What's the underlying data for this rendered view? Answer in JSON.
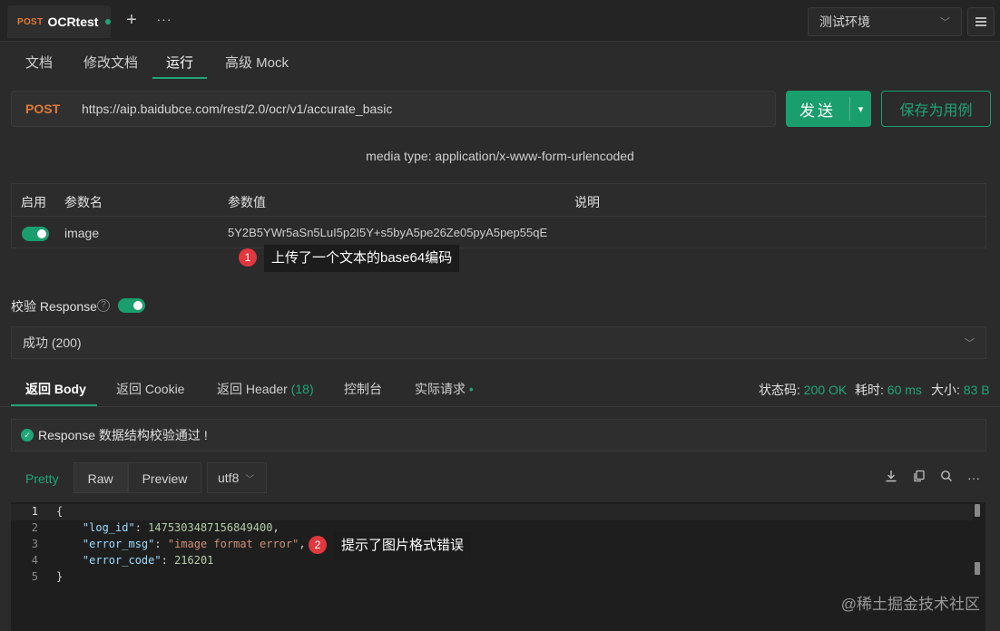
{
  "top_tab": {
    "method": "POST",
    "name": "OCRtest",
    "plus": "+",
    "more": "···"
  },
  "env": {
    "label": "测试环境",
    "chevron": "﹀"
  },
  "sub_tabs": [
    "文档",
    "修改文档",
    "运行",
    "高级 Mock"
  ],
  "request": {
    "method": "POST",
    "url": "https://aip.baidubce.com/rest/2.0/ocr/v1/accurate_basic",
    "send_label": "发送",
    "send_arrow": "▾",
    "save_label": "保存为用例"
  },
  "media_type": "media type: application/x-www-form-urlencoded",
  "params": {
    "headers": [
      "启用",
      "参数名",
      "参数值",
      "说明"
    ],
    "row": {
      "enabled": true,
      "name": "image",
      "value": "5Y2B5YWr5aSn5LuI5p2I5Y+s5byA5pe26Ze05pyA5pep55qE",
      "desc": ""
    }
  },
  "annotations": [
    {
      "num": "1",
      "text": "上传了一个文本的base64编码"
    },
    {
      "num": "2",
      "text": "提示了图片格式错误"
    }
  ],
  "validation": {
    "label": "校验 Response",
    "help": "?",
    "status": "成功 (200)",
    "chevron": "﹀"
  },
  "response_tabs": [
    {
      "label": "返回 Body"
    },
    {
      "label": "返回 Cookie"
    },
    {
      "label": "返回 Header",
      "count": "(18)"
    },
    {
      "label": "控制台"
    },
    {
      "label": "实际请求",
      "dot": "•"
    }
  ],
  "stats": {
    "status_label": "状态码:",
    "status_value": "200 OK",
    "time_label": "耗时:",
    "time_value": "60 ms",
    "size_label": "大小:",
    "size_value": "83 B"
  },
  "ok_message": "Response 数据结构校验通过 !",
  "format_tabs": [
    "Pretty",
    "Raw",
    "Preview"
  ],
  "encoding": "utf8",
  "tool_icons": [
    "download-icon",
    "copy-icon",
    "search-icon",
    "more-icon"
  ],
  "code": {
    "line_numbers": [
      "1",
      "2",
      "3",
      "4",
      "5"
    ],
    "open_brace": "{",
    "close_brace": "}",
    "log_id_key": "\"log_id\"",
    "log_id_value": "1475303487156849400",
    "error_msg_key": "\"error_msg\"",
    "error_msg_value": "\"image format error\"",
    "error_code_key": "\"error_code\"",
    "error_code_value": "216201"
  },
  "watermark": "@稀土掘金技术社区",
  "colors": {
    "accent": "#1fa578",
    "post_method": "#e07a3a",
    "badge": "#e0383e"
  }
}
